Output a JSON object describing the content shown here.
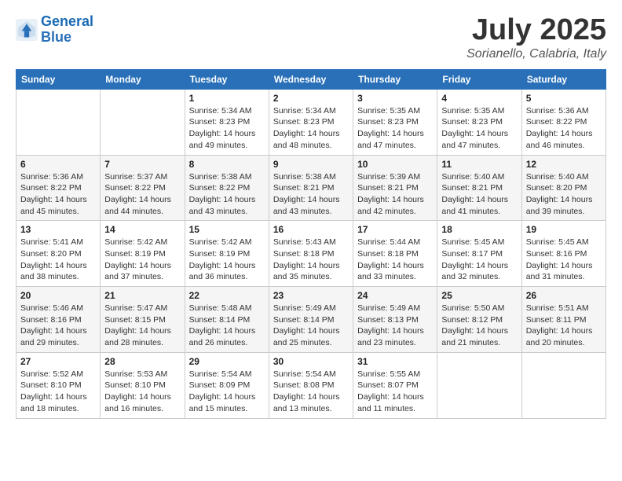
{
  "logo": {
    "line1": "General",
    "line2": "Blue"
  },
  "title": "July 2025",
  "subtitle": "Sorianello, Calabria, Italy",
  "days_of_week": [
    "Sunday",
    "Monday",
    "Tuesday",
    "Wednesday",
    "Thursday",
    "Friday",
    "Saturday"
  ],
  "weeks": [
    [
      {
        "day": "",
        "info": ""
      },
      {
        "day": "",
        "info": ""
      },
      {
        "day": "1",
        "info": "Sunrise: 5:34 AM\nSunset: 8:23 PM\nDaylight: 14 hours and 49 minutes."
      },
      {
        "day": "2",
        "info": "Sunrise: 5:34 AM\nSunset: 8:23 PM\nDaylight: 14 hours and 48 minutes."
      },
      {
        "day": "3",
        "info": "Sunrise: 5:35 AM\nSunset: 8:23 PM\nDaylight: 14 hours and 47 minutes."
      },
      {
        "day": "4",
        "info": "Sunrise: 5:35 AM\nSunset: 8:23 PM\nDaylight: 14 hours and 47 minutes."
      },
      {
        "day": "5",
        "info": "Sunrise: 5:36 AM\nSunset: 8:22 PM\nDaylight: 14 hours and 46 minutes."
      }
    ],
    [
      {
        "day": "6",
        "info": "Sunrise: 5:36 AM\nSunset: 8:22 PM\nDaylight: 14 hours and 45 minutes."
      },
      {
        "day": "7",
        "info": "Sunrise: 5:37 AM\nSunset: 8:22 PM\nDaylight: 14 hours and 44 minutes."
      },
      {
        "day": "8",
        "info": "Sunrise: 5:38 AM\nSunset: 8:22 PM\nDaylight: 14 hours and 43 minutes."
      },
      {
        "day": "9",
        "info": "Sunrise: 5:38 AM\nSunset: 8:21 PM\nDaylight: 14 hours and 43 minutes."
      },
      {
        "day": "10",
        "info": "Sunrise: 5:39 AM\nSunset: 8:21 PM\nDaylight: 14 hours and 42 minutes."
      },
      {
        "day": "11",
        "info": "Sunrise: 5:40 AM\nSunset: 8:21 PM\nDaylight: 14 hours and 41 minutes."
      },
      {
        "day": "12",
        "info": "Sunrise: 5:40 AM\nSunset: 8:20 PM\nDaylight: 14 hours and 39 minutes."
      }
    ],
    [
      {
        "day": "13",
        "info": "Sunrise: 5:41 AM\nSunset: 8:20 PM\nDaylight: 14 hours and 38 minutes."
      },
      {
        "day": "14",
        "info": "Sunrise: 5:42 AM\nSunset: 8:19 PM\nDaylight: 14 hours and 37 minutes."
      },
      {
        "day": "15",
        "info": "Sunrise: 5:42 AM\nSunset: 8:19 PM\nDaylight: 14 hours and 36 minutes."
      },
      {
        "day": "16",
        "info": "Sunrise: 5:43 AM\nSunset: 8:18 PM\nDaylight: 14 hours and 35 minutes."
      },
      {
        "day": "17",
        "info": "Sunrise: 5:44 AM\nSunset: 8:18 PM\nDaylight: 14 hours and 33 minutes."
      },
      {
        "day": "18",
        "info": "Sunrise: 5:45 AM\nSunset: 8:17 PM\nDaylight: 14 hours and 32 minutes."
      },
      {
        "day": "19",
        "info": "Sunrise: 5:45 AM\nSunset: 8:16 PM\nDaylight: 14 hours and 31 minutes."
      }
    ],
    [
      {
        "day": "20",
        "info": "Sunrise: 5:46 AM\nSunset: 8:16 PM\nDaylight: 14 hours and 29 minutes."
      },
      {
        "day": "21",
        "info": "Sunrise: 5:47 AM\nSunset: 8:15 PM\nDaylight: 14 hours and 28 minutes."
      },
      {
        "day": "22",
        "info": "Sunrise: 5:48 AM\nSunset: 8:14 PM\nDaylight: 14 hours and 26 minutes."
      },
      {
        "day": "23",
        "info": "Sunrise: 5:49 AM\nSunset: 8:14 PM\nDaylight: 14 hours and 25 minutes."
      },
      {
        "day": "24",
        "info": "Sunrise: 5:49 AM\nSunset: 8:13 PM\nDaylight: 14 hours and 23 minutes."
      },
      {
        "day": "25",
        "info": "Sunrise: 5:50 AM\nSunset: 8:12 PM\nDaylight: 14 hours and 21 minutes."
      },
      {
        "day": "26",
        "info": "Sunrise: 5:51 AM\nSunset: 8:11 PM\nDaylight: 14 hours and 20 minutes."
      }
    ],
    [
      {
        "day": "27",
        "info": "Sunrise: 5:52 AM\nSunset: 8:10 PM\nDaylight: 14 hours and 18 minutes."
      },
      {
        "day": "28",
        "info": "Sunrise: 5:53 AM\nSunset: 8:10 PM\nDaylight: 14 hours and 16 minutes."
      },
      {
        "day": "29",
        "info": "Sunrise: 5:54 AM\nSunset: 8:09 PM\nDaylight: 14 hours and 15 minutes."
      },
      {
        "day": "30",
        "info": "Sunrise: 5:54 AM\nSunset: 8:08 PM\nDaylight: 14 hours and 13 minutes."
      },
      {
        "day": "31",
        "info": "Sunrise: 5:55 AM\nSunset: 8:07 PM\nDaylight: 14 hours and 11 minutes."
      },
      {
        "day": "",
        "info": ""
      },
      {
        "day": "",
        "info": ""
      }
    ]
  ]
}
